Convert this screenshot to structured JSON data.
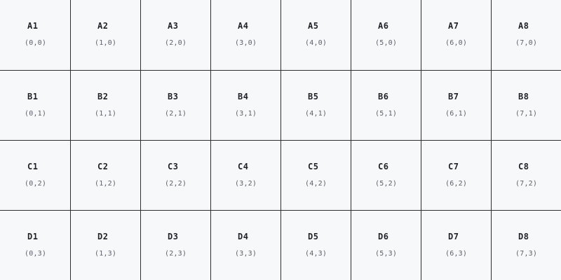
{
  "colors": {
    "cell_background": "#f7f8fa",
    "grid_line": "#2e2e2e",
    "label_text": "#1f2328",
    "coord_text": "#5b6068"
  },
  "grid": {
    "rows": [
      {
        "cells": [
          {
            "label": "A1",
            "coord": "(0,0)"
          },
          {
            "label": "A2",
            "coord": "(1,0)"
          },
          {
            "label": "A3",
            "coord": "(2,0)"
          },
          {
            "label": "A4",
            "coord": "(3,0)"
          },
          {
            "label": "A5",
            "coord": "(4,0)"
          },
          {
            "label": "A6",
            "coord": "(5,0)"
          },
          {
            "label": "A7",
            "coord": "(6,0)"
          },
          {
            "label": "A8",
            "coord": "(7,0)"
          }
        ]
      },
      {
        "cells": [
          {
            "label": "B1",
            "coord": "(0,1)"
          },
          {
            "label": "B2",
            "coord": "(1,1)"
          },
          {
            "label": "B3",
            "coord": "(2,1)"
          },
          {
            "label": "B4",
            "coord": "(3,1)"
          },
          {
            "label": "B5",
            "coord": "(4,1)"
          },
          {
            "label": "B6",
            "coord": "(5,1)"
          },
          {
            "label": "B7",
            "coord": "(6,1)"
          },
          {
            "label": "B8",
            "coord": "(7,1)"
          }
        ]
      },
      {
        "cells": [
          {
            "label": "C1",
            "coord": "(0,2)"
          },
          {
            "label": "C2",
            "coord": "(1,2)"
          },
          {
            "label": "C3",
            "coord": "(2,2)"
          },
          {
            "label": "C4",
            "coord": "(3,2)"
          },
          {
            "label": "C5",
            "coord": "(4,2)"
          },
          {
            "label": "C6",
            "coord": "(5,2)"
          },
          {
            "label": "C7",
            "coord": "(6,2)"
          },
          {
            "label": "C8",
            "coord": "(7,2)"
          }
        ]
      },
      {
        "cells": [
          {
            "label": "D1",
            "coord": "(0,3)"
          },
          {
            "label": "D2",
            "coord": "(1,3)"
          },
          {
            "label": "D3",
            "coord": "(2,3)"
          },
          {
            "label": "D4",
            "coord": "(3,3)"
          },
          {
            "label": "D5",
            "coord": "(4,3)"
          },
          {
            "label": "D6",
            "coord": "(5,3)"
          },
          {
            "label": "D7",
            "coord": "(6,3)"
          },
          {
            "label": "D8",
            "coord": "(7,3)"
          }
        ]
      }
    ]
  }
}
